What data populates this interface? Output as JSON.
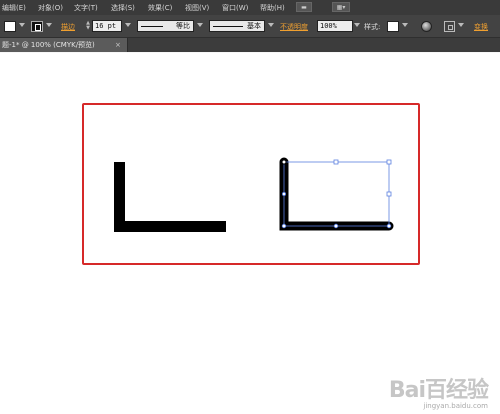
{
  "menubar": {
    "items": [
      {
        "label": "编辑(E)"
      },
      {
        "label": "对象(O)"
      },
      {
        "label": "文字(T)"
      },
      {
        "label": "选择(S)"
      },
      {
        "label": "效果(C)"
      },
      {
        "label": "视图(V)"
      },
      {
        "label": "窗口(W)"
      },
      {
        "label": "帮助(H)"
      }
    ]
  },
  "control_bar": {
    "stroke_link": "描边",
    "stroke_weight": "16 pt",
    "stroke_profile": "等比",
    "brush_definition": "基本",
    "opacity_link": "不透明度",
    "opacity_value": "100%",
    "style_label": "样式:",
    "transform_link": "变换"
  },
  "document_tab": {
    "title": "题-1* @ 100% (CMYK/预览)",
    "close": "×"
  },
  "watermark": {
    "logo": "Bai百经验",
    "url": "jingyan.baidu.com"
  },
  "colors": {
    "frame_border": "#d62929",
    "selection": "#5b7fe0",
    "accent_orange": "#f0a030"
  }
}
